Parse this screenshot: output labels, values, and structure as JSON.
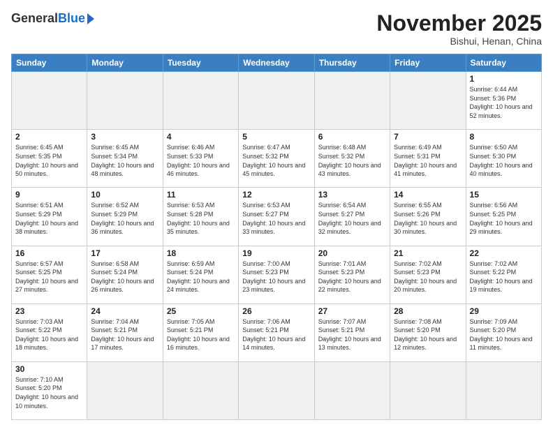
{
  "header": {
    "logo_general": "General",
    "logo_blue": "Blue",
    "month_title": "November 2025",
    "subtitle": "Bishui, Henan, China"
  },
  "weekdays": [
    "Sunday",
    "Monday",
    "Tuesday",
    "Wednesday",
    "Thursday",
    "Friday",
    "Saturday"
  ],
  "weeks": [
    [
      {
        "day": "",
        "empty": true
      },
      {
        "day": "",
        "empty": true
      },
      {
        "day": "",
        "empty": true
      },
      {
        "day": "",
        "empty": true
      },
      {
        "day": "",
        "empty": true
      },
      {
        "day": "",
        "empty": true
      },
      {
        "day": "1",
        "rise": "6:44 AM",
        "set": "5:36 PM",
        "daylight": "10 hours and 52 minutes."
      }
    ],
    [
      {
        "day": "2",
        "rise": "6:45 AM",
        "set": "5:35 PM",
        "daylight": "10 hours and 50 minutes."
      },
      {
        "day": "3",
        "rise": "6:45 AM",
        "set": "5:34 PM",
        "daylight": "10 hours and 48 minutes."
      },
      {
        "day": "4",
        "rise": "6:46 AM",
        "set": "5:33 PM",
        "daylight": "10 hours and 46 minutes."
      },
      {
        "day": "5",
        "rise": "6:47 AM",
        "set": "5:32 PM",
        "daylight": "10 hours and 45 minutes."
      },
      {
        "day": "6",
        "rise": "6:48 AM",
        "set": "5:32 PM",
        "daylight": "10 hours and 43 minutes."
      },
      {
        "day": "7",
        "rise": "6:49 AM",
        "set": "5:31 PM",
        "daylight": "10 hours and 41 minutes."
      },
      {
        "day": "8",
        "rise": "6:50 AM",
        "set": "5:30 PM",
        "daylight": "10 hours and 40 minutes."
      }
    ],
    [
      {
        "day": "9",
        "rise": "6:51 AM",
        "set": "5:29 PM",
        "daylight": "10 hours and 38 minutes."
      },
      {
        "day": "10",
        "rise": "6:52 AM",
        "set": "5:29 PM",
        "daylight": "10 hours and 36 minutes."
      },
      {
        "day": "11",
        "rise": "6:53 AM",
        "set": "5:28 PM",
        "daylight": "10 hours and 35 minutes."
      },
      {
        "day": "12",
        "rise": "6:53 AM",
        "set": "5:27 PM",
        "daylight": "10 hours and 33 minutes."
      },
      {
        "day": "13",
        "rise": "6:54 AM",
        "set": "5:27 PM",
        "daylight": "10 hours and 32 minutes."
      },
      {
        "day": "14",
        "rise": "6:55 AM",
        "set": "5:26 PM",
        "daylight": "10 hours and 30 minutes."
      },
      {
        "day": "15",
        "rise": "6:56 AM",
        "set": "5:25 PM",
        "daylight": "10 hours and 29 minutes."
      }
    ],
    [
      {
        "day": "16",
        "rise": "6:57 AM",
        "set": "5:25 PM",
        "daylight": "10 hours and 27 minutes."
      },
      {
        "day": "17",
        "rise": "6:58 AM",
        "set": "5:24 PM",
        "daylight": "10 hours and 26 minutes."
      },
      {
        "day": "18",
        "rise": "6:59 AM",
        "set": "5:24 PM",
        "daylight": "10 hours and 24 minutes."
      },
      {
        "day": "19",
        "rise": "7:00 AM",
        "set": "5:23 PM",
        "daylight": "10 hours and 23 minutes."
      },
      {
        "day": "20",
        "rise": "7:01 AM",
        "set": "5:23 PM",
        "daylight": "10 hours and 22 minutes."
      },
      {
        "day": "21",
        "rise": "7:02 AM",
        "set": "5:23 PM",
        "daylight": "10 hours and 20 minutes."
      },
      {
        "day": "22",
        "rise": "7:02 AM",
        "set": "5:22 PM",
        "daylight": "10 hours and 19 minutes."
      }
    ],
    [
      {
        "day": "23",
        "rise": "7:03 AM",
        "set": "5:22 PM",
        "daylight": "10 hours and 18 minutes."
      },
      {
        "day": "24",
        "rise": "7:04 AM",
        "set": "5:21 PM",
        "daylight": "10 hours and 17 minutes."
      },
      {
        "day": "25",
        "rise": "7:05 AM",
        "set": "5:21 PM",
        "daylight": "10 hours and 16 minutes."
      },
      {
        "day": "26",
        "rise": "7:06 AM",
        "set": "5:21 PM",
        "daylight": "10 hours and 14 minutes."
      },
      {
        "day": "27",
        "rise": "7:07 AM",
        "set": "5:21 PM",
        "daylight": "10 hours and 13 minutes."
      },
      {
        "day": "28",
        "rise": "7:08 AM",
        "set": "5:20 PM",
        "daylight": "10 hours and 12 minutes."
      },
      {
        "day": "29",
        "rise": "7:09 AM",
        "set": "5:20 PM",
        "daylight": "10 hours and 11 minutes."
      }
    ],
    [
      {
        "day": "30",
        "rise": "7:10 AM",
        "set": "5:20 PM",
        "daylight": "10 hours and 10 minutes."
      },
      {
        "day": "",
        "empty": true
      },
      {
        "day": "",
        "empty": true
      },
      {
        "day": "",
        "empty": true
      },
      {
        "day": "",
        "empty": true
      },
      {
        "day": "",
        "empty": true
      },
      {
        "day": "",
        "empty": true
      }
    ]
  ]
}
